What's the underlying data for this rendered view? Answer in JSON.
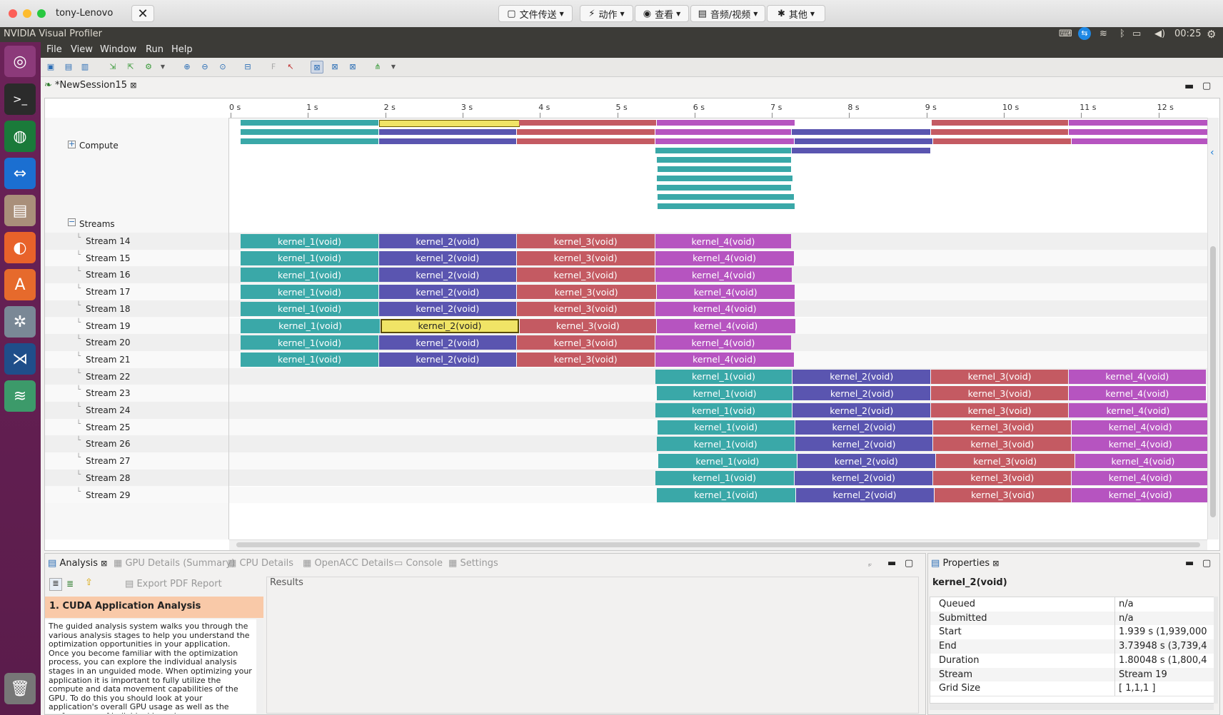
{
  "mac": {
    "window_title": "tony-Lenovo",
    "buttons": [
      "文件传送",
      "动作",
      "查看",
      "音频/视频",
      "其他"
    ]
  },
  "panel": {
    "app_title": "NVIDIA Visual Profiler",
    "clock": "00:25"
  },
  "menu": [
    "File",
    "View",
    "Window",
    "Run",
    "Help"
  ],
  "editor_tab": "*NewSession15",
  "ruler_ticks": [
    "0 s",
    "1 s",
    "2 s",
    "3 s",
    "4 s",
    "5 s",
    "6 s",
    "7 s",
    "8 s",
    "9 s",
    "10 s",
    "11 s",
    "12 s"
  ],
  "tree": {
    "compute": "Compute",
    "streams": "Streams"
  },
  "kernel_names": [
    "kernel_1(void)",
    "kernel_2(void)",
    "kernel_3(void)",
    "kernel_4(void)"
  ],
  "colors": {
    "k1": "#3aa8a8",
    "k2": "#5a55b0",
    "k3": "#c45a62",
    "k4": "#b654c0",
    "selected": "#f0e466"
  },
  "streams": [
    {
      "label": "Stream 14",
      "k": [
        0.13,
        1.92,
        3.7,
        5.49,
        7.26
      ]
    },
    {
      "label": "Stream 15",
      "k": [
        0.13,
        1.92,
        3.7,
        5.49,
        7.29
      ]
    },
    {
      "label": "Stream 16",
      "k": [
        0.13,
        1.92,
        3.7,
        5.49,
        7.27
      ]
    },
    {
      "label": "Stream 17",
      "k": [
        0.13,
        1.92,
        3.7,
        5.51,
        7.3
      ]
    },
    {
      "label": "Stream 18",
      "k": [
        0.13,
        1.92,
        3.7,
        5.49,
        7.3
      ]
    },
    {
      "label": "Stream 19",
      "k": [
        0.13,
        1.939,
        3.739,
        5.51,
        7.31
      ],
      "selected": 1
    },
    {
      "label": "Stream 20",
      "k": [
        0.13,
        1.92,
        3.7,
        5.49,
        7.26
      ]
    },
    {
      "label": "Stream 21",
      "k": [
        0.13,
        1.92,
        3.7,
        5.49,
        7.29
      ]
    },
    {
      "label": "Stream 22",
      "k": [
        5.49,
        7.27,
        9.06,
        10.84,
        12.62
      ]
    },
    {
      "label": "Stream 23",
      "k": [
        5.51,
        7.28,
        9.06,
        10.84,
        12.62
      ]
    },
    {
      "label": "Stream 24",
      "k": [
        5.49,
        7.27,
        9.06,
        10.84,
        12.64
      ]
    },
    {
      "label": "Stream 25",
      "k": [
        5.52,
        7.3,
        9.09,
        10.88,
        12.66
      ]
    },
    {
      "label": "Stream 26",
      "k": [
        5.51,
        7.3,
        9.09,
        10.88,
        12.66
      ]
    },
    {
      "label": "Stream 27",
      "k": [
        5.53,
        7.33,
        9.12,
        10.92,
        12.69
      ]
    },
    {
      "label": "Stream 28",
      "k": [
        5.49,
        7.29,
        9.09,
        10.88,
        12.66
      ]
    },
    {
      "label": "Stream 29",
      "k": [
        5.51,
        7.31,
        9.1,
        10.88,
        12.66
      ]
    }
  ],
  "analysis": {
    "tabs": [
      "Analysis",
      "GPU Details (Summary)",
      "CPU Details",
      "OpenACC Details",
      "Console",
      "Settings"
    ],
    "export_label": "Export PDF Report",
    "section_title": "1. CUDA Application Analysis",
    "body": "The guided analysis system walks you through the various analysis stages to help you understand the optimization opportunities in your application. Once you become familiar with the optimization process, you can explore the individual analysis stages in an unguided mode. When optimizing your application it is important to fully utilize the compute and data movement capabilities of the GPU. To do this you should look at your application's overall GPU usage as well as the performance of individual kernels.",
    "results_label": "Results"
  },
  "properties": {
    "tab": "Properties",
    "title": "kernel_2(void)",
    "rows": [
      {
        "k": "Queued",
        "v": "n/a"
      },
      {
        "k": "Submitted",
        "v": "n/a"
      },
      {
        "k": "Start",
        "v": "1.939 s (1,939,000"
      },
      {
        "k": "End",
        "v": "3.73948 s (3,739,4"
      },
      {
        "k": "Duration",
        "v": "1.80048 s (1,800,4"
      },
      {
        "k": "Stream",
        "v": "Stream 19"
      },
      {
        "k": "Grid Size",
        "v": "[ 1,1,1 ]"
      }
    ]
  }
}
